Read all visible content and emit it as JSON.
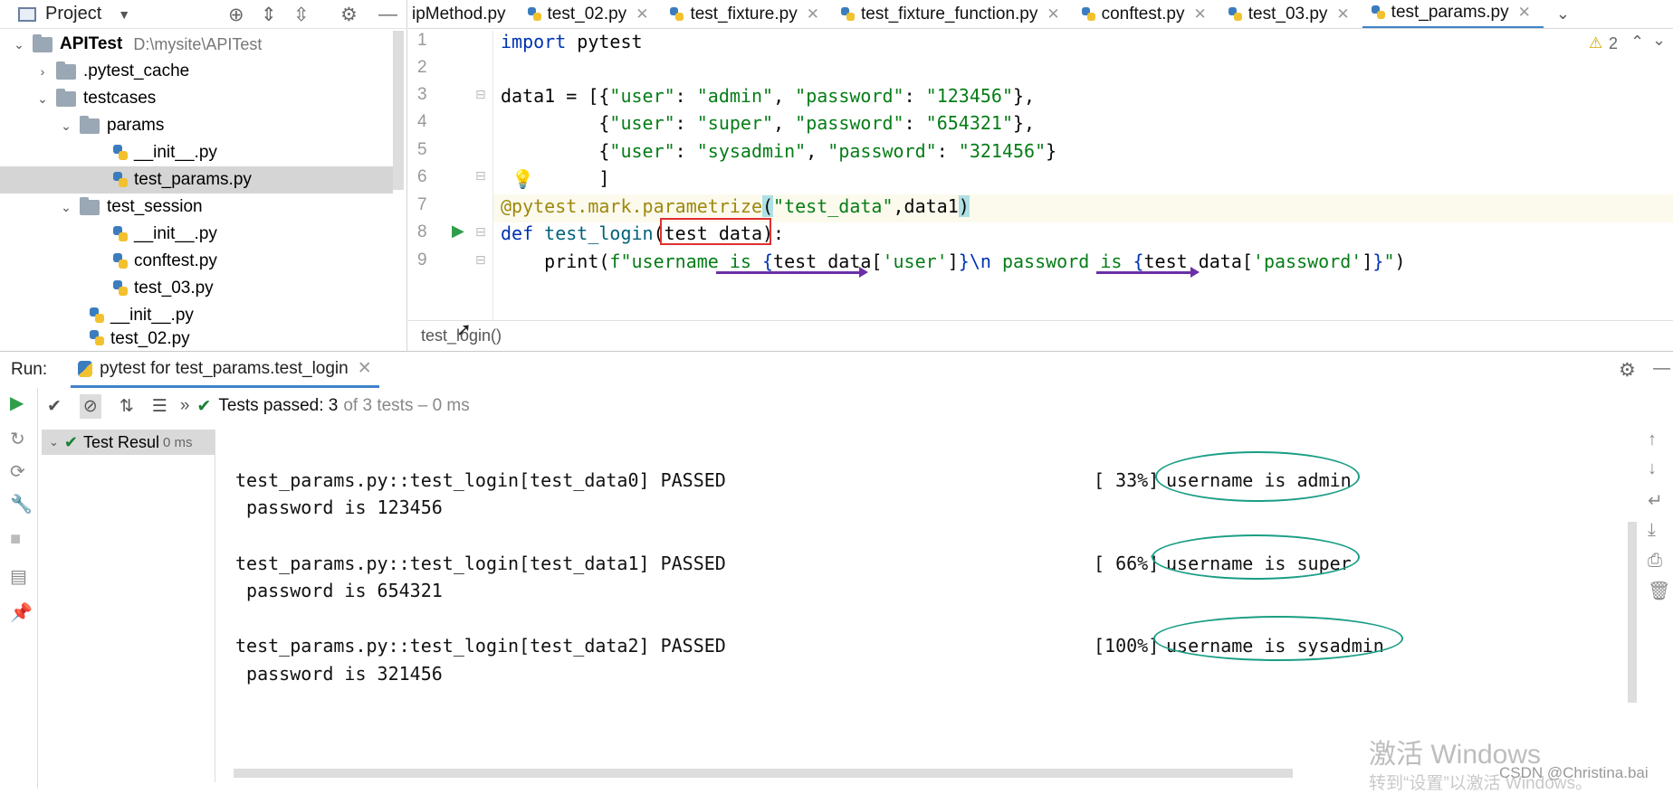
{
  "project": {
    "title": "Project",
    "tree": [
      {
        "label": "APITest",
        "path": "D:\\mysite\\APITest"
      },
      {
        "label": ".pytest_cache"
      },
      {
        "label": "testcases"
      },
      {
        "label": "params"
      },
      {
        "label": "__init__.py"
      },
      {
        "label": "test_params.py"
      },
      {
        "label": "test_session"
      },
      {
        "label": "__init__.py"
      },
      {
        "label": "conftest.py"
      },
      {
        "label": "test_03.py"
      },
      {
        "label": "__init__.py"
      },
      {
        "label": "test_02.py"
      }
    ]
  },
  "tabs": [
    {
      "label": "ipMethod.py"
    },
    {
      "label": "test_02.py"
    },
    {
      "label": "test_fixture.py"
    },
    {
      "label": "test_fixture_function.py"
    },
    {
      "label": "conftest.py"
    },
    {
      "label": "test_03.py"
    },
    {
      "label": "test_params.py"
    }
  ],
  "editor": {
    "warnings": "2",
    "line_numbers": [
      "1",
      "2",
      "3",
      "4",
      "5",
      "6",
      "7",
      "8",
      "9"
    ],
    "breadcrumb": "test_login()"
  },
  "run": {
    "label": "Run:",
    "tab": "pytest for test_params.test_login",
    "status": "Tests passed: 3",
    "status_detail": "of 3 tests – 0 ms",
    "tree_label": "Test Resul",
    "tree_time": "0 ms",
    "console": [
      {
        "test": "test_params.py::test_login[test_data0] PASSED",
        "pct": "[ 33%]",
        "out": "username is admin",
        "pw": " password is 123456"
      },
      {
        "test": "test_params.py::test_login[test_data1] PASSED",
        "pct": "[ 66%]",
        "out": "username is super",
        "pw": " password is 654321"
      },
      {
        "test": "test_params.py::test_login[test_data2] PASSED",
        "pct": "[100%]",
        "out": "username is sysadmin",
        "pw": " password is 321456"
      }
    ]
  },
  "watermark": {
    "line1": "激活 Windows",
    "line2": "转到“设置”以激活 Windows。",
    "credit": "CSDN @Christina.bai"
  },
  "colors": {
    "accent": "#4083c9",
    "pass": "#1a7f37",
    "oval": "#1a9e85",
    "highlight_box": "#e03030",
    "arrow": "#6a2fa6"
  }
}
